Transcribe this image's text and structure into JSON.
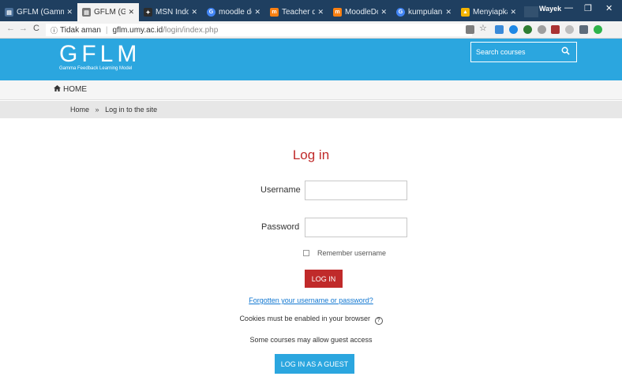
{
  "browser": {
    "tabs": [
      {
        "title": "GFLM (Gamma",
        "icon": "document-icon",
        "color": "#4a6f98"
      },
      {
        "title": "GFLM (Gamma",
        "icon": "document-icon",
        "color": "#777777",
        "active": true
      },
      {
        "title": "MSN Indonesi",
        "icon": "msn-icon",
        "color": "#2c2c2c"
      },
      {
        "title": "moodle docum",
        "icon": "google-icon",
        "color": "#4285f4"
      },
      {
        "title": "Teacher quick",
        "icon": "moodle-icon",
        "color": "#f98012"
      },
      {
        "title": "MoodleDocs",
        "icon": "moodle-icon",
        "color": "#f98012"
      },
      {
        "title": "kumpulan sind",
        "icon": "google-icon",
        "color": "#4285f4"
      },
      {
        "title": "Menyiapkan A",
        "icon": "google-drive-icon",
        "color": "#f4b400"
      }
    ],
    "profile": "Wayek",
    "address_insecure_label": "Tidak aman",
    "address_domain": "gflm.umy.ac.id",
    "address_path": "/login/index.php"
  },
  "site": {
    "logo": "GFLM",
    "logo_subtitle": "Gamma Feedback Learning Model",
    "search_placeholder": "Search courses",
    "accent": "#2ba6df"
  },
  "nav": {
    "home": "HOME"
  },
  "breadcrumb": {
    "home": "Home",
    "separator": "»",
    "current": "Log in to the site"
  },
  "login": {
    "title": "Log in",
    "username_label": "Username",
    "password_label": "Password",
    "remember_label": "Remember username",
    "submit_label": "LOG IN",
    "forgot_link": "Forgotten your username or password?",
    "cookies_text": "Cookies must be enabled in your browser",
    "guest_note": "Some courses may allow guest access",
    "guest_button": "LOG IN AS A GUEST",
    "submit_color": "#c02a2a"
  }
}
